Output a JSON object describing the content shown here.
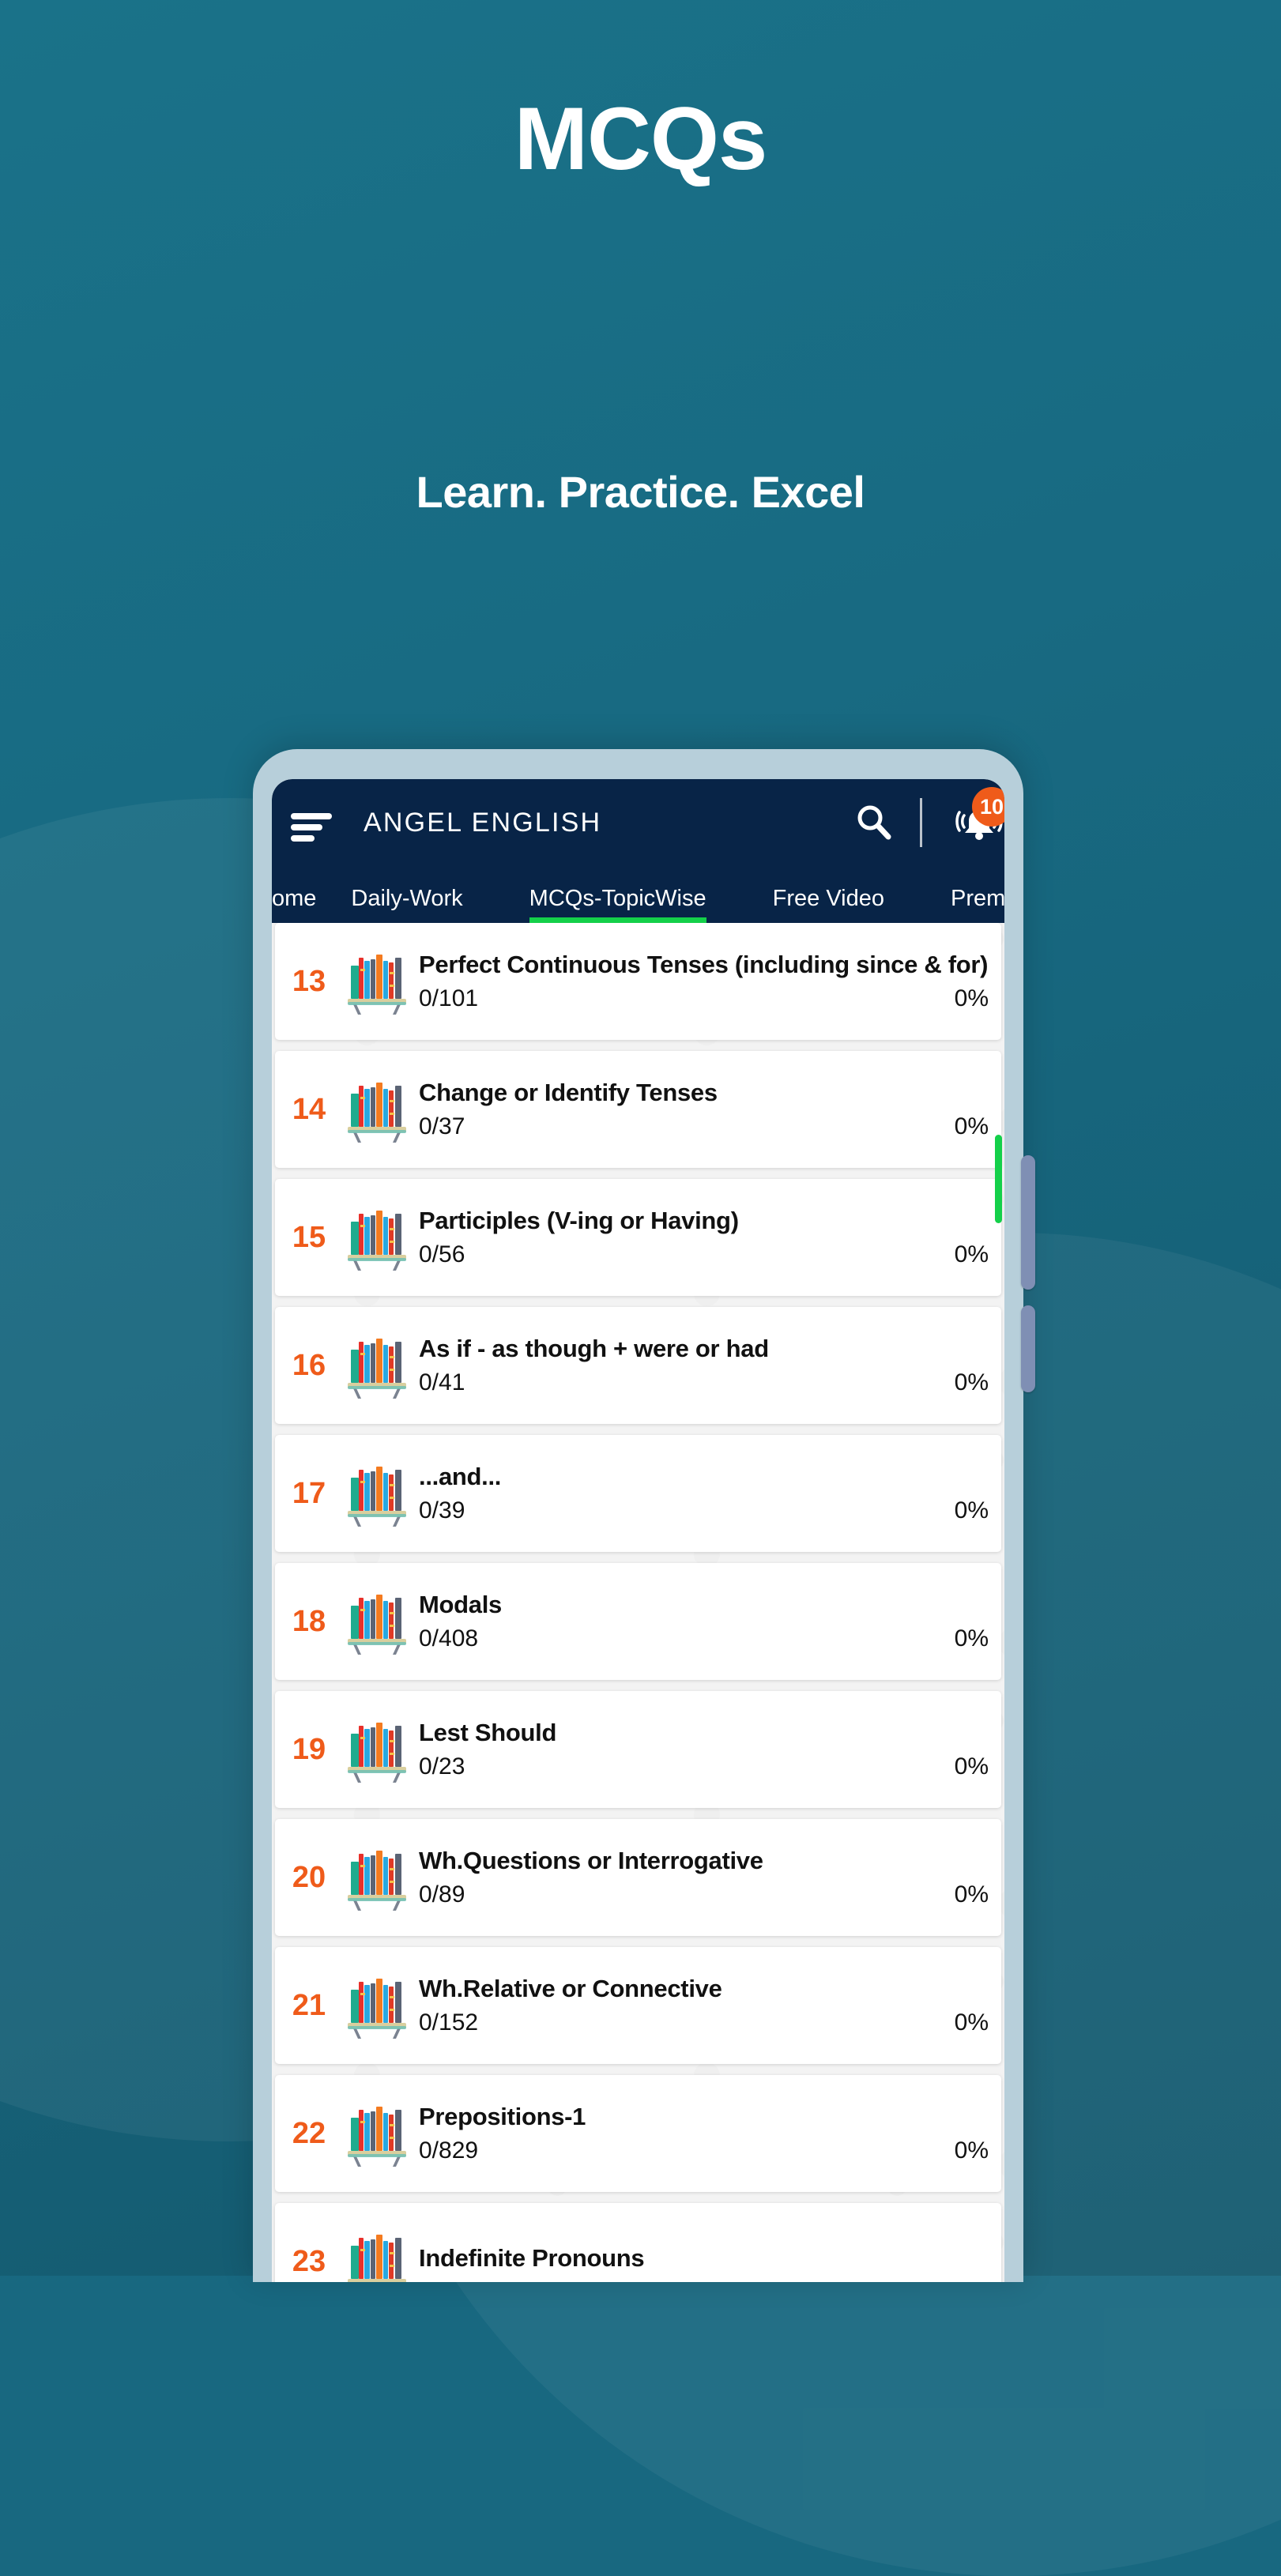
{
  "promo": {
    "title": "MCQs",
    "subtitle": "Learn. Practice. Excel",
    "background_color": "#186880",
    "title_color": "#ffffff"
  },
  "app": {
    "header": {
      "menu_icon": "hamburger-menu-icon",
      "title": "ANGEL ENGLISH",
      "search_icon": "search-icon",
      "notification_icon": "bell-icon",
      "notification_count": "10",
      "badge_color": "#ef5b1a",
      "bar_color": "#082447"
    },
    "tabs": {
      "active_indicator_color": "#14d04a",
      "items": [
        {
          "label": "ome",
          "active": false
        },
        {
          "label": "Daily-Work",
          "active": false
        },
        {
          "label": "MCQs-TopicWise",
          "active": true
        },
        {
          "label": "Free Video",
          "active": false
        },
        {
          "label": "Premiu",
          "active": false
        }
      ]
    },
    "list": {
      "number_color": "#ef5b1a",
      "item_icon": "bookshelf-icon",
      "rows": [
        {
          "number": "13",
          "title": "Perfect Continuous Tenses (including since & for)",
          "count": "0/101",
          "percent": "0%"
        },
        {
          "number": "14",
          "title": "Change or Identify Tenses",
          "count": "0/37",
          "percent": "0%"
        },
        {
          "number": "15",
          "title": "Participles (V-ing or Having)",
          "count": "0/56",
          "percent": "0%"
        },
        {
          "number": "16",
          "title": "As if - as though + were or had",
          "count": "0/41",
          "percent": "0%"
        },
        {
          "number": "17",
          "title": "...and...",
          "count": "0/39",
          "percent": "0%"
        },
        {
          "number": "18",
          "title": "Modals",
          "count": "0/408",
          "percent": "0%"
        },
        {
          "number": "19",
          "title": "Lest Should",
          "count": "0/23",
          "percent": "0%"
        },
        {
          "number": "20",
          "title": "Wh.Questions or Interrogative",
          "count": "0/89",
          "percent": "0%"
        },
        {
          "number": "21",
          "title": "Wh.Relative or Connective",
          "count": "0/152",
          "percent": "0%"
        },
        {
          "number": "22",
          "title": "Prepositions-1",
          "count": "0/829",
          "percent": "0%"
        },
        {
          "number": "23",
          "title": "Indefinite Pronouns",
          "count": "",
          "percent": ""
        }
      ]
    }
  }
}
